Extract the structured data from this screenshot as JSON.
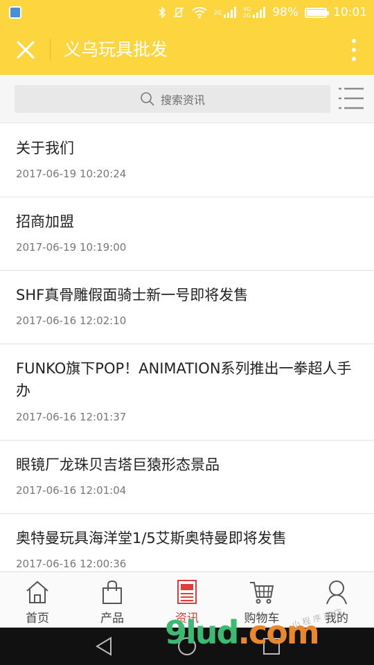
{
  "status_bar": {
    "network_labels": [
      "4G",
      "2G"
    ],
    "battery": "98%",
    "battery_level": 0.98,
    "time": "10:01"
  },
  "header": {
    "title": "义乌玩具批发"
  },
  "search": {
    "placeholder": "搜索资讯"
  },
  "articles": [
    {
      "title": "关于我们",
      "date": "2017-06-19 10:20:24"
    },
    {
      "title": "招商加盟",
      "date": "2017-06-19 10:19:00"
    },
    {
      "title": "SHF真骨雕假面骑士新一号即将发售",
      "date": "2017-06-16 12:02:10"
    },
    {
      "title": "FUNKO旗下POP！ANIMATION系列推出一拳超人手办",
      "date": "2017-06-16 12:01:37"
    },
    {
      "title": "眼镜厂龙珠贝吉塔巨猿形态景品",
      "date": "2017-06-16 12:01:04"
    },
    {
      "title": "奥特曼玩具海洋堂1/5艾斯奥特曼即将发售",
      "date": "2017-06-16 12:00:36"
    }
  ],
  "bottom_nav": [
    {
      "label": "首页",
      "icon": "home-icon"
    },
    {
      "label": "产品",
      "icon": "shopping-bag-icon"
    },
    {
      "label": "资讯",
      "icon": "newspaper-icon",
      "active": true
    },
    {
      "label": "购物车",
      "icon": "cart-icon"
    },
    {
      "label": "我的",
      "icon": "user-icon"
    }
  ],
  "watermark": {
    "main": "9lud",
    "suffix": ".com",
    "tag": "小 程 序 商 店"
  },
  "colors": {
    "header": "#fcd53f",
    "active": "#e23b3b",
    "watermark_green": "#3cba72",
    "watermark_orange": "#e9872f"
  }
}
